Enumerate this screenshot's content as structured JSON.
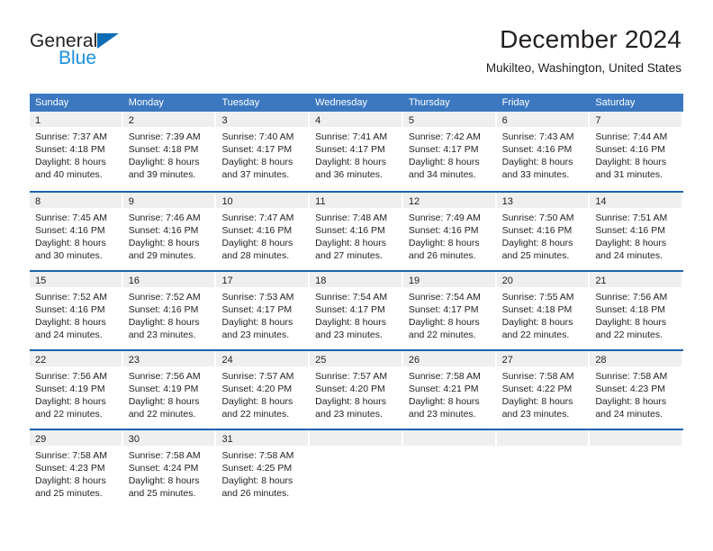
{
  "brand": {
    "name_part1": "General",
    "name_part2": "Blue",
    "triangle_color": "#0d6cb6",
    "blue_text_color": "#1a8fe0"
  },
  "header": {
    "title": "December 2024",
    "subtitle": "Mukilteo, Washington, United States"
  },
  "theme": {
    "header_row_bg": "#3b78c0",
    "week_separator": "#1f62ad",
    "day_band_bg": "#efefef",
    "text": "#231f20"
  },
  "weekdays": [
    "Sunday",
    "Monday",
    "Tuesday",
    "Wednesday",
    "Thursday",
    "Friday",
    "Saturday"
  ],
  "weeks": [
    {
      "days": [
        {
          "number": "1",
          "sunrise": "Sunrise: 7:37 AM",
          "sunset": "Sunset: 4:18 PM",
          "daylight_line1": "Daylight: 8 hours",
          "daylight_line2": "and 40 minutes."
        },
        {
          "number": "2",
          "sunrise": "Sunrise: 7:39 AM",
          "sunset": "Sunset: 4:18 PM",
          "daylight_line1": "Daylight: 8 hours",
          "daylight_line2": "and 39 minutes."
        },
        {
          "number": "3",
          "sunrise": "Sunrise: 7:40 AM",
          "sunset": "Sunset: 4:17 PM",
          "daylight_line1": "Daylight: 8 hours",
          "daylight_line2": "and 37 minutes."
        },
        {
          "number": "4",
          "sunrise": "Sunrise: 7:41 AM",
          "sunset": "Sunset: 4:17 PM",
          "daylight_line1": "Daylight: 8 hours",
          "daylight_line2": "and 36 minutes."
        },
        {
          "number": "5",
          "sunrise": "Sunrise: 7:42 AM",
          "sunset": "Sunset: 4:17 PM",
          "daylight_line1": "Daylight: 8 hours",
          "daylight_line2": "and 34 minutes."
        },
        {
          "number": "6",
          "sunrise": "Sunrise: 7:43 AM",
          "sunset": "Sunset: 4:16 PM",
          "daylight_line1": "Daylight: 8 hours",
          "daylight_line2": "and 33 minutes."
        },
        {
          "number": "7",
          "sunrise": "Sunrise: 7:44 AM",
          "sunset": "Sunset: 4:16 PM",
          "daylight_line1": "Daylight: 8 hours",
          "daylight_line2": "and 31 minutes."
        }
      ]
    },
    {
      "days": [
        {
          "number": "8",
          "sunrise": "Sunrise: 7:45 AM",
          "sunset": "Sunset: 4:16 PM",
          "daylight_line1": "Daylight: 8 hours",
          "daylight_line2": "and 30 minutes."
        },
        {
          "number": "9",
          "sunrise": "Sunrise: 7:46 AM",
          "sunset": "Sunset: 4:16 PM",
          "daylight_line1": "Daylight: 8 hours",
          "daylight_line2": "and 29 minutes."
        },
        {
          "number": "10",
          "sunrise": "Sunrise: 7:47 AM",
          "sunset": "Sunset: 4:16 PM",
          "daylight_line1": "Daylight: 8 hours",
          "daylight_line2": "and 28 minutes."
        },
        {
          "number": "11",
          "sunrise": "Sunrise: 7:48 AM",
          "sunset": "Sunset: 4:16 PM",
          "daylight_line1": "Daylight: 8 hours",
          "daylight_line2": "and 27 minutes."
        },
        {
          "number": "12",
          "sunrise": "Sunrise: 7:49 AM",
          "sunset": "Sunset: 4:16 PM",
          "daylight_line1": "Daylight: 8 hours",
          "daylight_line2": "and 26 minutes."
        },
        {
          "number": "13",
          "sunrise": "Sunrise: 7:50 AM",
          "sunset": "Sunset: 4:16 PM",
          "daylight_line1": "Daylight: 8 hours",
          "daylight_line2": "and 25 minutes."
        },
        {
          "number": "14",
          "sunrise": "Sunrise: 7:51 AM",
          "sunset": "Sunset: 4:16 PM",
          "daylight_line1": "Daylight: 8 hours",
          "daylight_line2": "and 24 minutes."
        }
      ]
    },
    {
      "days": [
        {
          "number": "15",
          "sunrise": "Sunrise: 7:52 AM",
          "sunset": "Sunset: 4:16 PM",
          "daylight_line1": "Daylight: 8 hours",
          "daylight_line2": "and 24 minutes."
        },
        {
          "number": "16",
          "sunrise": "Sunrise: 7:52 AM",
          "sunset": "Sunset: 4:16 PM",
          "daylight_line1": "Daylight: 8 hours",
          "daylight_line2": "and 23 minutes."
        },
        {
          "number": "17",
          "sunrise": "Sunrise: 7:53 AM",
          "sunset": "Sunset: 4:17 PM",
          "daylight_line1": "Daylight: 8 hours",
          "daylight_line2": "and 23 minutes."
        },
        {
          "number": "18",
          "sunrise": "Sunrise: 7:54 AM",
          "sunset": "Sunset: 4:17 PM",
          "daylight_line1": "Daylight: 8 hours",
          "daylight_line2": "and 23 minutes."
        },
        {
          "number": "19",
          "sunrise": "Sunrise: 7:54 AM",
          "sunset": "Sunset: 4:17 PM",
          "daylight_line1": "Daylight: 8 hours",
          "daylight_line2": "and 22 minutes."
        },
        {
          "number": "20",
          "sunrise": "Sunrise: 7:55 AM",
          "sunset": "Sunset: 4:18 PM",
          "daylight_line1": "Daylight: 8 hours",
          "daylight_line2": "and 22 minutes."
        },
        {
          "number": "21",
          "sunrise": "Sunrise: 7:56 AM",
          "sunset": "Sunset: 4:18 PM",
          "daylight_line1": "Daylight: 8 hours",
          "daylight_line2": "and 22 minutes."
        }
      ]
    },
    {
      "days": [
        {
          "number": "22",
          "sunrise": "Sunrise: 7:56 AM",
          "sunset": "Sunset: 4:19 PM",
          "daylight_line1": "Daylight: 8 hours",
          "daylight_line2": "and 22 minutes."
        },
        {
          "number": "23",
          "sunrise": "Sunrise: 7:56 AM",
          "sunset": "Sunset: 4:19 PM",
          "daylight_line1": "Daylight: 8 hours",
          "daylight_line2": "and 22 minutes."
        },
        {
          "number": "24",
          "sunrise": "Sunrise: 7:57 AM",
          "sunset": "Sunset: 4:20 PM",
          "daylight_line1": "Daylight: 8 hours",
          "daylight_line2": "and 22 minutes."
        },
        {
          "number": "25",
          "sunrise": "Sunrise: 7:57 AM",
          "sunset": "Sunset: 4:20 PM",
          "daylight_line1": "Daylight: 8 hours",
          "daylight_line2": "and 23 minutes."
        },
        {
          "number": "26",
          "sunrise": "Sunrise: 7:58 AM",
          "sunset": "Sunset: 4:21 PM",
          "daylight_line1": "Daylight: 8 hours",
          "daylight_line2": "and 23 minutes."
        },
        {
          "number": "27",
          "sunrise": "Sunrise: 7:58 AM",
          "sunset": "Sunset: 4:22 PM",
          "daylight_line1": "Daylight: 8 hours",
          "daylight_line2": "and 23 minutes."
        },
        {
          "number": "28",
          "sunrise": "Sunrise: 7:58 AM",
          "sunset": "Sunset: 4:23 PM",
          "daylight_line1": "Daylight: 8 hours",
          "daylight_line2": "and 24 minutes."
        }
      ]
    },
    {
      "days": [
        {
          "number": "29",
          "sunrise": "Sunrise: 7:58 AM",
          "sunset": "Sunset: 4:23 PM",
          "daylight_line1": "Daylight: 8 hours",
          "daylight_line2": "and 25 minutes."
        },
        {
          "number": "30",
          "sunrise": "Sunrise: 7:58 AM",
          "sunset": "Sunset: 4:24 PM",
          "daylight_line1": "Daylight: 8 hours",
          "daylight_line2": "and 25 minutes."
        },
        {
          "number": "31",
          "sunrise": "Sunrise: 7:58 AM",
          "sunset": "Sunset: 4:25 PM",
          "daylight_line1": "Daylight: 8 hours",
          "daylight_line2": "and 26 minutes."
        },
        {
          "number": "",
          "sunrise": "",
          "sunset": "",
          "daylight_line1": "",
          "daylight_line2": ""
        },
        {
          "number": "",
          "sunrise": "",
          "sunset": "",
          "daylight_line1": "",
          "daylight_line2": ""
        },
        {
          "number": "",
          "sunrise": "",
          "sunset": "",
          "daylight_line1": "",
          "daylight_line2": ""
        },
        {
          "number": "",
          "sunrise": "",
          "sunset": "",
          "daylight_line1": "",
          "daylight_line2": ""
        }
      ]
    }
  ]
}
